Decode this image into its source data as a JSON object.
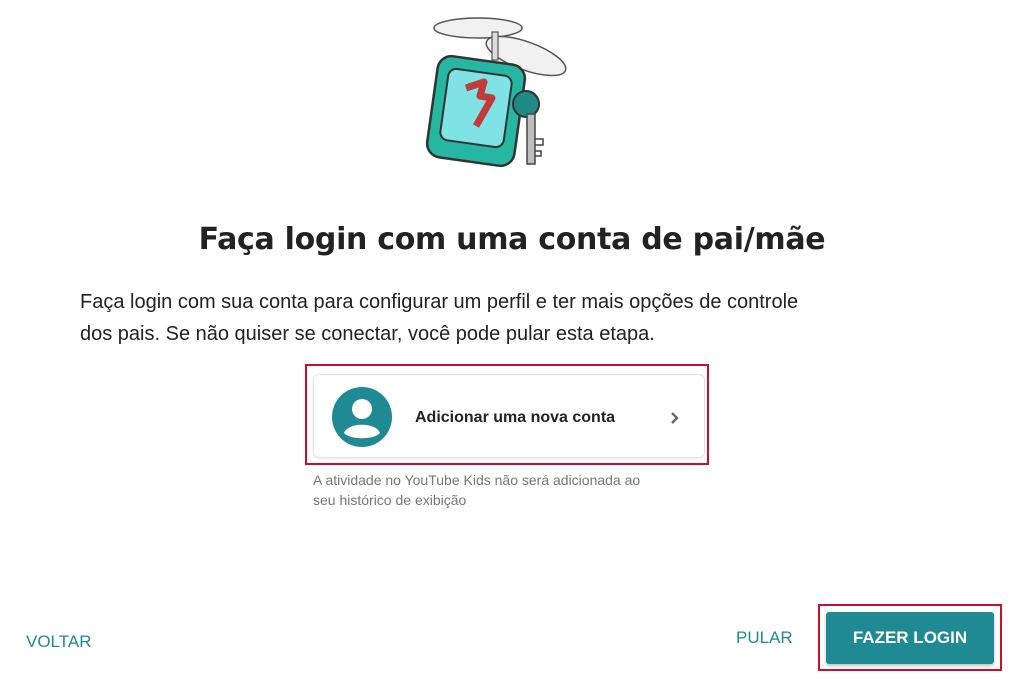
{
  "header": {
    "illustration_icon": "flying-key-robot-illustration",
    "title": "Faça login com uma conta de pai/mãe",
    "description_line1": "Faça login com sua conta para configurar um perfil e ter mais opções de controle",
    "description_line2": "dos pais. Se não quiser se conectar, você pode pular esta etapa."
  },
  "account_option": {
    "avatar_icon": "account-circle-icon",
    "label": "Adicionar uma nova conta",
    "chevron_icon": "chevron-right-icon",
    "note_line1": "A atividade no YouTube Kids não será adicionada ao",
    "note_line2": "seu histórico de exibição"
  },
  "footer": {
    "back_label": "VOLTAR",
    "skip_label": "PULAR",
    "login_label": "FAZER LOGIN"
  },
  "colors": {
    "accent": "#1f8a93",
    "highlight": "#c8102e",
    "text": "#222222",
    "muted": "#777777"
  }
}
